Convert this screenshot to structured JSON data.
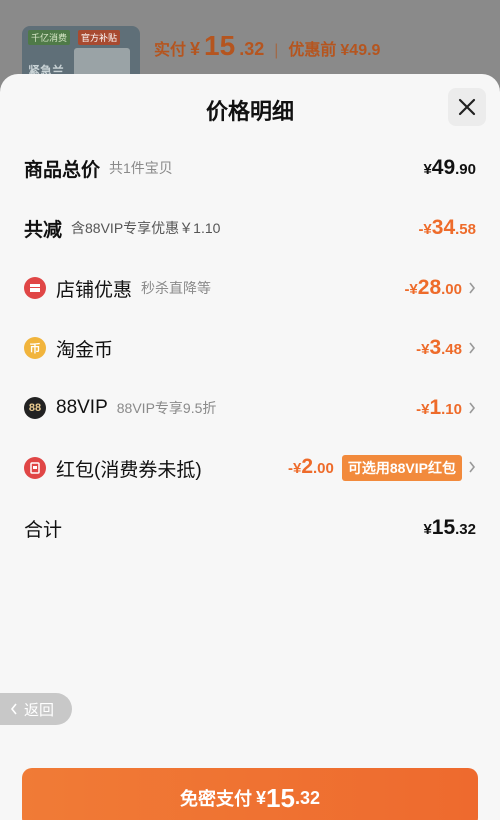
{
  "background": {
    "thumb_tag_left": "千亿消费",
    "thumb_tag_right": "官方补贴",
    "thumb_label": "紧急兰",
    "price_label": "实付",
    "price_currency": "¥",
    "price_int": "15",
    "price_dec": ".32",
    "separator": "|",
    "original_label": "优惠前",
    "original_value": "¥49.9"
  },
  "sheet": {
    "title": "价格明细",
    "close_icon": "close-icon"
  },
  "rows": {
    "total": {
      "label": "商品总价",
      "sub": "共1件宝贝",
      "currency": "¥",
      "int": "49",
      "dec": ".90"
    },
    "reduce": {
      "label": "共减",
      "sub": "含88VIP专享优惠￥1.10",
      "currency": "-¥",
      "int": "34",
      "dec": ".58"
    },
    "shop": {
      "label": "店铺优惠",
      "sub": "秒杀直降等",
      "currency": "-¥",
      "int": "28",
      "dec": ".00"
    },
    "coin": {
      "label": "淘金币",
      "icon_text": "币",
      "currency": "-¥",
      "int": "3",
      "dec": ".48"
    },
    "vip": {
      "label": "88VIP",
      "icon_text": "88",
      "sub": "88VIP专享9.5折",
      "currency": "-¥",
      "int": "1",
      "dec": ".10"
    },
    "redpacket": {
      "label": "红包(消费券未抵)",
      "currency": "-¥",
      "int": "2",
      "dec": ".00",
      "tag": "可选用88VIP红包"
    },
    "sum": {
      "label": "合计",
      "currency": "¥",
      "int": "15",
      "dec": ".32"
    }
  },
  "back": {
    "label": "返回"
  },
  "pay": {
    "label": "免密支付",
    "currency": "¥",
    "int": "15",
    "dec": ".32"
  },
  "colors": {
    "accent": "#ee6b2a",
    "tag": "#f28a3c",
    "red_icon": "#e04646",
    "gold_icon": "#f1b43c"
  }
}
